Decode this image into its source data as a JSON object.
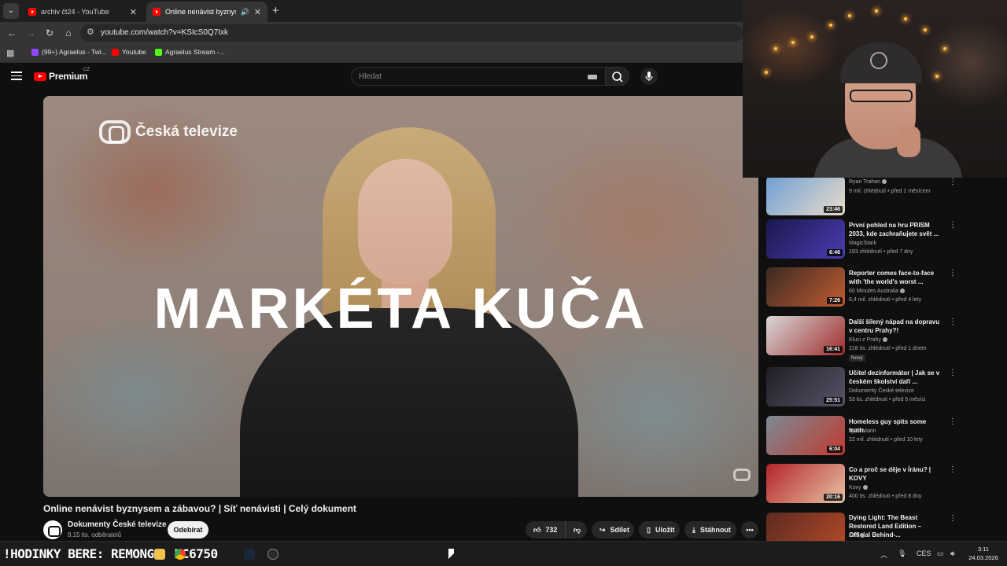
{
  "browser": {
    "tabs": [
      {
        "title": "archiv čt24 - YouTube"
      },
      {
        "title": "Online nenávist byznysem"
      }
    ],
    "url": "youtube.com/watch?v=KSIcS0Q7Ixk",
    "bookmarks": [
      {
        "label": "(99+) Agraelus - Twi..."
      },
      {
        "label": "Youtube"
      },
      {
        "label": "Agraelus Stream -..."
      }
    ]
  },
  "youtube": {
    "logo_text": "Premium",
    "logo_region": "CZ",
    "search_placeholder": "Hledat"
  },
  "video": {
    "overlay_logo": "Česká televize",
    "overlay_name": "MARKÉTA KUČA",
    "title": "Online nenávist byznysem a zábavou? | Síť nenávisti | Celý dokument",
    "channel": "Dokumenty České televize",
    "subscribers": "9,15 tis. odběratelů",
    "subscribe_label": "Odebírat",
    "likes": "732",
    "share_label": "Sdílet",
    "save_label": "Uložit",
    "download_label": "Stáhnout"
  },
  "recommendations": [
    {
      "title": "",
      "channel": "Ryan Trahan",
      "meta": "9 mil. zhlédnutí • před 1 měsícem",
      "duration": "23:46",
      "thumb_color": "#6f9fd6"
    },
    {
      "title": "První pohled na hru PRISM 2033, kde zachraňujete svět ...",
      "channel": "MagicStark",
      "meta": "193 zhlédnutí • před 7 dny",
      "duration": "6:46",
      "thumb_color": "#2a1f6e"
    },
    {
      "title": "Reporter comes face-to-face with 'the world's worst ...",
      "channel": "60 Minutes Australia",
      "meta": "6,4 mil. zhlédnutí • před 4 lety",
      "duration": "7:26",
      "thumb_color": "#c25b34"
    },
    {
      "title": "Další šílený nápad na dopravu v centru Prahy?!",
      "channel": "Kluci z Prahy",
      "meta": "218 tis. zhlédnutí • před 1 dnem",
      "duration": "16:41",
      "badge": "Nový",
      "thumb_color": "#a02c2c"
    },
    {
      "title": "Učitel dezinformátor | Jak se v českém školství daří ...",
      "channel": "Dokumenty České televize",
      "meta": "53 tis. zhlédnutí • před 5 měsíci",
      "duration": "25:51",
      "thumb_color": "#3a3646"
    },
    {
      "title": "Homeless guy spits some truth.",
      "channel": "Tyler Mann",
      "meta": "22 mil. zhlédnutí • před 10 lety",
      "duration": "6:04",
      "thumb_color": "#7c8a96"
    },
    {
      "title": "Co a proč se děje v Íránu? | KOVY",
      "channel": "Kovy",
      "meta": "400 tis. zhlédnutí • před 8 dny",
      "duration": "20:16",
      "thumb_color": "#b4242a"
    },
    {
      "title": "Dying Light: The Beast Restored Land Edition – Official Behind-...",
      "channel": "IGN",
      "meta": "",
      "duration": "",
      "thumb_color": "#5a2a20"
    }
  ],
  "taskbar": {
    "ticker": "!HODINKY BERE: REMONG",
    "ticker_tail": "KC6750",
    "keyboard_lang": "CES",
    "time": "3:11",
    "date": "24.03.2026"
  }
}
